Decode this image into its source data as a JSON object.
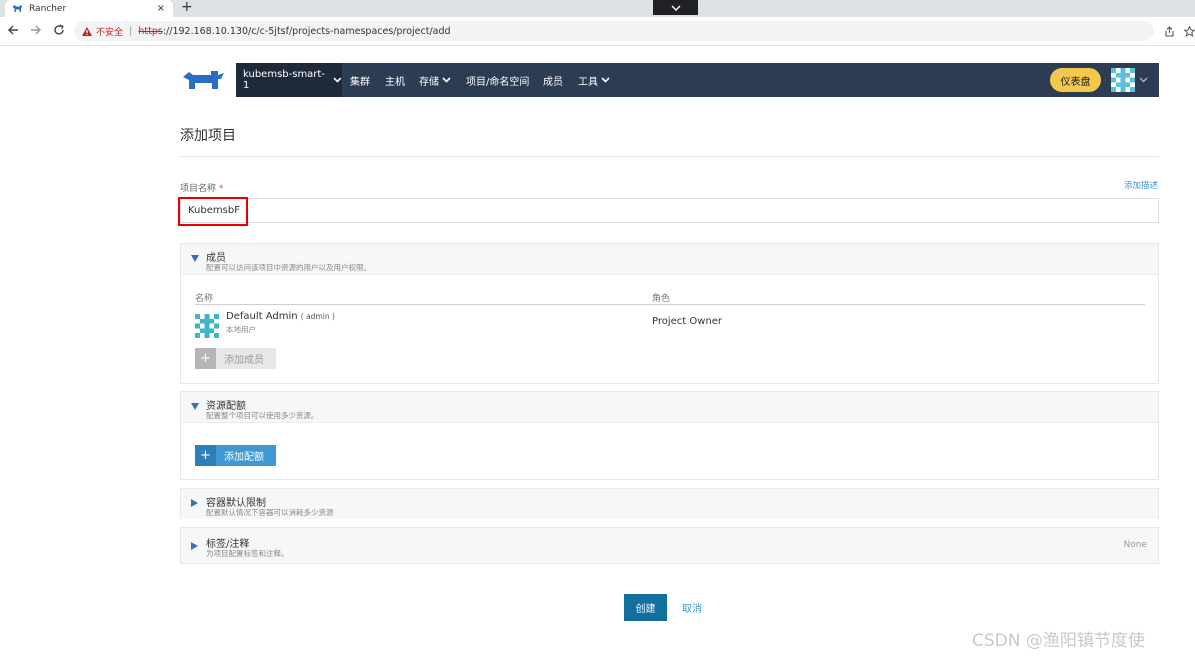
{
  "browser": {
    "tab_title": "Rancher",
    "tab_close": "×",
    "new_tab": "+",
    "insecure_label": "不安全",
    "url_scheme": "https",
    "url_rest": "://192.168.10.130/c/c-5jtsf/projects-namespaces/project/add"
  },
  "header": {
    "cluster_name": "kubemsb-smart-1",
    "nav": [
      "集群",
      "主机",
      "存储",
      "项目/命名空间",
      "成员",
      "工具"
    ],
    "dashboard_label": "仪表盘"
  },
  "page": {
    "title": "添加项目",
    "project_name_label": "项目名称",
    "required_mark": "*",
    "add_description": "添加描述",
    "project_name_value": "KubemsbF"
  },
  "members": {
    "title": "成员",
    "subtitle": "配置可以访问该项目中资源的用户以及用户权限。",
    "col_name": "名称",
    "col_role": "角色",
    "rows": [
      {
        "display_name": "Default  Admin",
        "username": "( admin )",
        "type": "本地用户",
        "role": "Project Owner"
      }
    ],
    "add_button": "添加成员"
  },
  "quota": {
    "title": "资源配额",
    "subtitle": "配置整个项目可以使用多少资源。",
    "add_button": "添加配额"
  },
  "container_limits": {
    "title": "容器默认限制",
    "subtitle": "配置默认情况下容器可以消耗多少资源"
  },
  "labels": {
    "title": "标签/注释",
    "subtitle": "为项目配置标签和注释。",
    "value": "None"
  },
  "actions": {
    "create": "创建",
    "cancel": "取消"
  },
  "watermark": "CSDN @渔阳镇节度使",
  "colors": {
    "header_bg": "#2b3c53",
    "accent_blue": "#3d98d3",
    "create_btn": "#146fa1",
    "dashboard_btn": "#f2c94c",
    "highlight": "#e60000"
  }
}
